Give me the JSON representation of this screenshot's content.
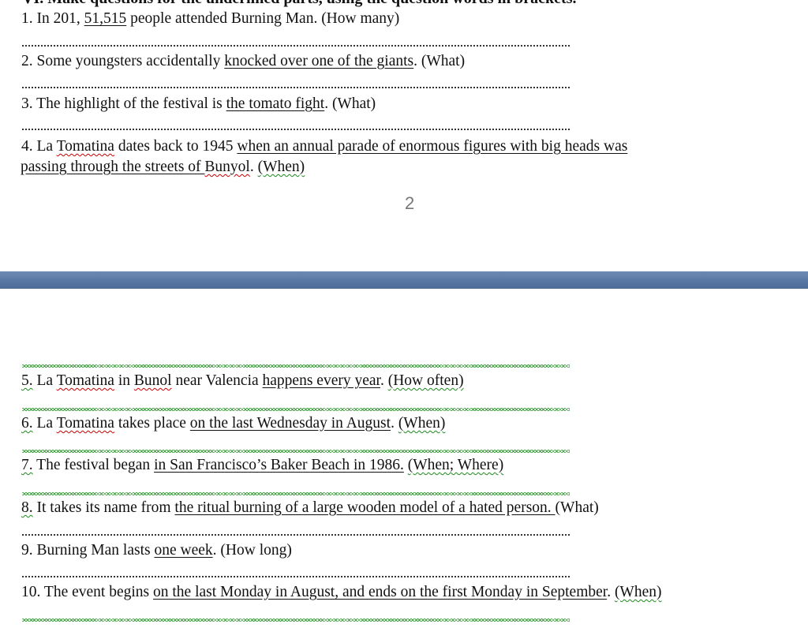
{
  "heading": "VI. Make questions for the underlined parts, using the question words in brackets.",
  "page_number": "2",
  "questions": [
    {
      "num": "1.",
      "parts": [
        "In 201, ",
        "51,515",
        " people attended Burning Man. (How many)"
      ]
    },
    {
      "num": "2.",
      "parts": [
        "Some youngsters accidentally ",
        "knocked over one of the giants",
        ". (What)"
      ]
    },
    {
      "num": "3.",
      "parts": [
        "The highlight of the festival is ",
        "the tomato fight",
        ". (What)"
      ]
    },
    {
      "num": "4.",
      "parts": [
        "La ",
        "Tomatina",
        " dates back to 1945 ",
        "when an annual parade of enormous figures with big heads was",
        "passing through the streets of ",
        "Bunyol",
        ". ",
        "(When)"
      ]
    },
    {
      "num": "5.",
      "parts": [
        "La ",
        "Tomatina",
        " in ",
        "Bunol",
        " near Valencia ",
        "happens every year",
        ". ",
        "(How often)"
      ]
    },
    {
      "num": "6.",
      "parts": [
        "La ",
        "Tomatina",
        " takes place ",
        "on the last Wednesday in August",
        ". ",
        "(When)"
      ]
    },
    {
      "num": "7.",
      "parts": [
        "The festival began ",
        "in San Francisco’s Baker Beach in 1986.",
        " ",
        "(When; Where)"
      ]
    },
    {
      "num": "8.",
      "parts": [
        "It takes its name from ",
        "the ritual burning of a large wooden model of a hated person. ",
        "(What)"
      ]
    },
    {
      "num": "9.",
      "parts": [
        "Burning Man lasts ",
        "one week",
        ". (How long)"
      ]
    },
    {
      "num": "10.",
      "parts": [
        "The event begins ",
        "on the last Monday in August, and ends on the first Monday in September",
        ". ",
        "(When)"
      ]
    }
  ]
}
